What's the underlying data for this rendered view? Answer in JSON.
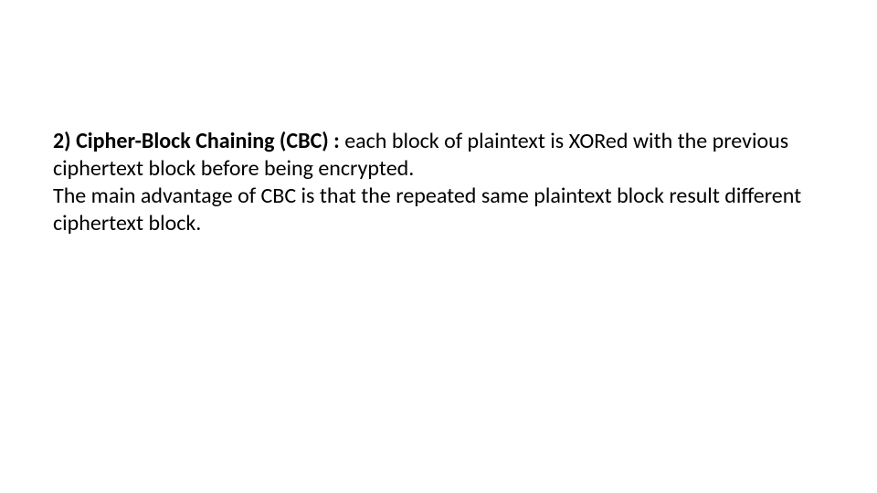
{
  "slide": {
    "heading_bold": "2) Cipher-Block Chaining (CBC) : ",
    "heading_rest": "each block of plaintext is XORed with the previous ciphertext block before being encrypted.",
    "paragraph2": "The main advantage of CBC is that the repeated same plaintext block result different ciphertext block."
  }
}
